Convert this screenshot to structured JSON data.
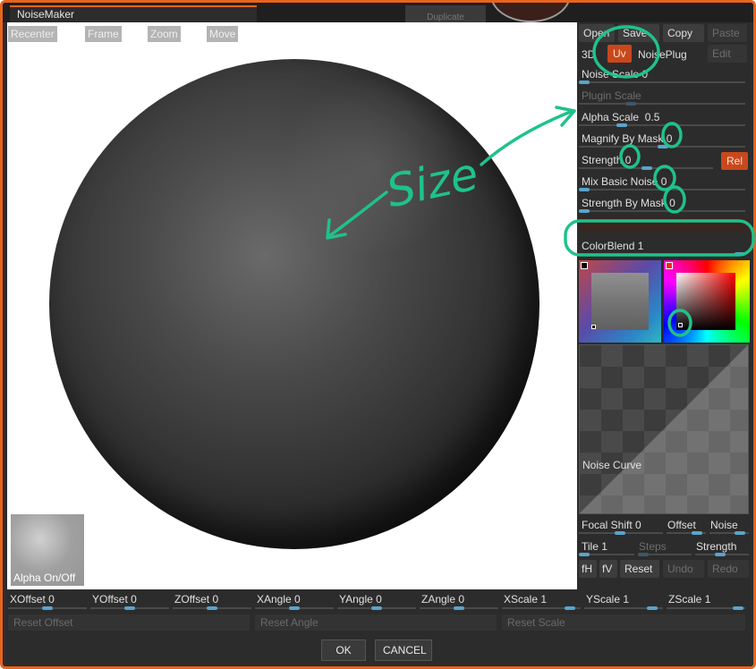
{
  "window": {
    "title": "NoiseMaker",
    "ghost_tab": "Duplicate"
  },
  "canvas": {
    "top_buttons": [
      "Recenter",
      "Frame",
      "Zoom",
      "Move"
    ],
    "alpha_label": "Alpha On/Off"
  },
  "panel": {
    "row1": [
      "Open",
      "Save",
      "Copy",
      "Paste"
    ],
    "row2": {
      "mode_3d": "3D",
      "uv": "Uv",
      "plug": "NoisePlug",
      "edit": "Edit"
    },
    "noise_scale": {
      "label": "Noise Scale",
      "value": "0"
    },
    "plugin_scale": {
      "label": "Plugin Scale"
    },
    "alpha_scale": {
      "label": "Alpha Scale",
      "value": "0.5"
    },
    "magnify": {
      "label": "Magnify By Mask",
      "value": "0"
    },
    "strength": {
      "label": "Strength",
      "value": "0",
      "rel": "Rel"
    },
    "mix": {
      "label": "Mix Basic Noise",
      "value": "0"
    },
    "strength_mask": {
      "label": "Strength By Mask",
      "value": "0"
    },
    "color_blend": {
      "label": "ColorBlend",
      "value": "1"
    },
    "noise_curve": "Noise Curve",
    "focal_shift": {
      "label": "Focal Shift",
      "value": "0"
    },
    "offset": "Offset",
    "noise": "Noise",
    "tile": {
      "label": "Tile",
      "value": "1"
    },
    "steps": "Steps",
    "strength2": "Strength",
    "bottom_btns": [
      "fH",
      "fV",
      "Reset",
      "Undo",
      "Redo"
    ]
  },
  "bottom": {
    "fields": [
      {
        "label": "XOffset",
        "value": "0"
      },
      {
        "label": "YOffset",
        "value": "0"
      },
      {
        "label": "ZOffset",
        "value": "0"
      },
      {
        "label": "XAngle",
        "value": "0"
      },
      {
        "label": "YAngle",
        "value": "0"
      },
      {
        "label": "ZAngle",
        "value": "0"
      },
      {
        "label": "XScale",
        "value": "1"
      },
      {
        "label": "YScale",
        "value": "1"
      },
      {
        "label": "ZScale",
        "value": "1"
      }
    ],
    "resets": [
      "Reset Offset",
      "Reset Angle",
      "Reset Scale"
    ],
    "ok": "OK",
    "cancel": "CANCEL"
  },
  "annotation": {
    "text": "Size",
    "color": "#1fc28a"
  },
  "colors": {
    "accent": "#e8641c",
    "slider": "#5aa4cc",
    "tag": "#c8481c"
  }
}
